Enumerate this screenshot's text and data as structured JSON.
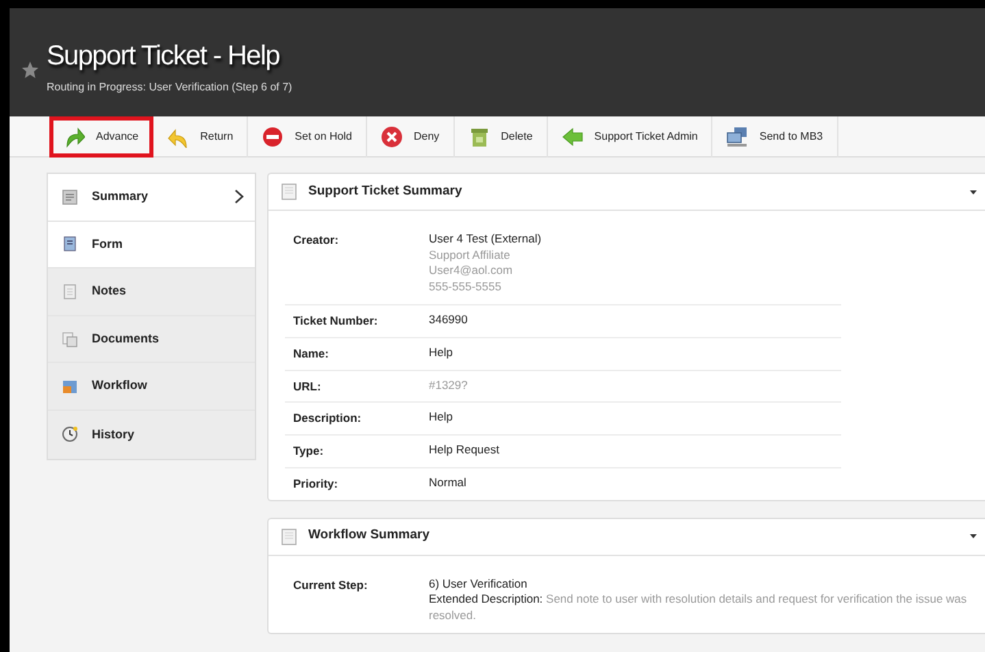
{
  "header": {
    "title": "Support Ticket - Help",
    "subtitle": "Routing in Progress: User Verification (Step 6 of 7)",
    "starred": false
  },
  "toolbar": [
    {
      "label": "Advance",
      "kind": "advance",
      "highlighted": true
    },
    {
      "label": "Return",
      "kind": "return",
      "highlighted": false
    },
    {
      "label": "Set on Hold",
      "kind": "hold",
      "highlighted": false
    },
    {
      "label": "Deny",
      "kind": "deny",
      "highlighted": false
    },
    {
      "label": "Delete",
      "kind": "delete",
      "highlighted": false
    },
    {
      "label": "Support Ticket Admin",
      "kind": "admin",
      "highlighted": false
    },
    {
      "label": "Send to MB3",
      "kind": "send",
      "highlighted": false
    }
  ],
  "sidebar": {
    "items": [
      {
        "label": "Summary",
        "kind": "summary",
        "selected": true,
        "highlighted": true
      },
      {
        "label": "Form",
        "kind": "form",
        "selected": false,
        "highlighted": true
      },
      {
        "label": "Notes",
        "kind": "notes",
        "selected": false,
        "highlighted": false
      },
      {
        "label": "Documents",
        "kind": "documents",
        "selected": false,
        "highlighted": false
      },
      {
        "label": "Workflow",
        "kind": "workflow",
        "selected": false,
        "highlighted": false
      },
      {
        "label": "History",
        "kind": "history",
        "selected": false,
        "highlighted": false
      }
    ]
  },
  "panels": [
    {
      "title": "Support Ticket Summary",
      "expanded": true,
      "rows": [
        {
          "label": "Creator:",
          "value": "User 4 Test (External)",
          "details": [
            "Support Affiliate",
            "User4@aol.com",
            "555-555-5555"
          ]
        },
        {
          "label": "Ticket Number:",
          "value": "346990"
        },
        {
          "label": "Name:",
          "value": "Help"
        },
        {
          "label": "URL:",
          "value": "#1329?",
          "muted": true
        },
        {
          "label": "Description:",
          "value": "Help"
        },
        {
          "label": "Type:",
          "value": "Help Request"
        },
        {
          "label": "Priority:",
          "value": "Normal"
        }
      ]
    },
    {
      "title": "Workflow Summary",
      "expanded": true,
      "rows": [
        {
          "label": "Current Step:",
          "value": "6) User Verification",
          "extended": {
            "label": "Extended Description:",
            "text": "Send note to user with resolution details and request for verification the issue was resolved."
          }
        }
      ]
    }
  ]
}
